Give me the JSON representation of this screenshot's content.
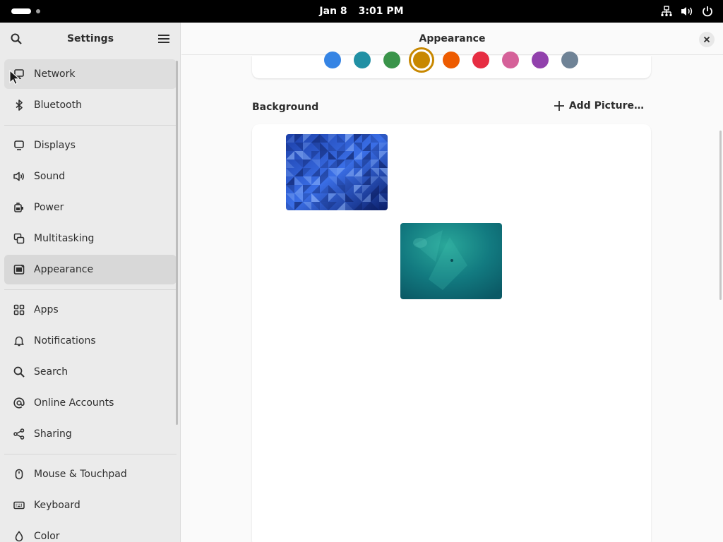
{
  "topbar": {
    "date": "Jan 8",
    "time": "3:01 PM",
    "icons": [
      "network-icon",
      "volume-icon",
      "power-icon"
    ]
  },
  "sidebar": {
    "title": "Settings",
    "groups": [
      [
        {
          "label": "Network",
          "icon": "network-icon"
        },
        {
          "label": "Bluetooth",
          "icon": "bluetooth-icon"
        }
      ],
      [
        {
          "label": "Displays",
          "icon": "display-icon"
        },
        {
          "label": "Sound",
          "icon": "sound-icon"
        },
        {
          "label": "Power",
          "icon": "power-icon"
        },
        {
          "label": "Multitasking",
          "icon": "multitasking-icon"
        },
        {
          "label": "Appearance",
          "icon": "appearance-icon",
          "selected": true
        }
      ],
      [
        {
          "label": "Apps",
          "icon": "apps-icon"
        },
        {
          "label": "Notifications",
          "icon": "bell-icon"
        },
        {
          "label": "Search",
          "icon": "search-icon"
        },
        {
          "label": "Online Accounts",
          "icon": "at-icon"
        },
        {
          "label": "Sharing",
          "icon": "share-icon"
        }
      ],
      [
        {
          "label": "Mouse & Touchpad",
          "icon": "mouse-icon"
        },
        {
          "label": "Keyboard",
          "icon": "keyboard-icon"
        },
        {
          "label": "Color",
          "icon": "color-icon"
        }
      ]
    ]
  },
  "main": {
    "title": "Appearance",
    "accent_colors": [
      "#3584e4",
      "#2190a4",
      "#3a944a",
      "#c88800",
      "#ed5b00",
      "#e62d42",
      "#d56199",
      "#9141ac",
      "#6f8396"
    ],
    "accent_selected": 3,
    "background_label": "Background",
    "add_picture_label": "Add Picture…",
    "wallpapers": [
      "blue-triangles-wallpaper",
      "teal-abstract-wallpaper"
    ]
  }
}
